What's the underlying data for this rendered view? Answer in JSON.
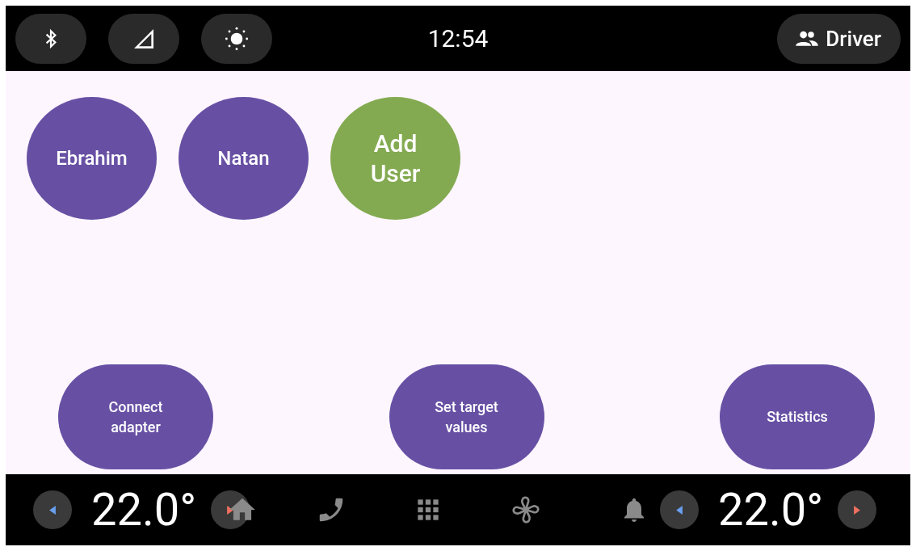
{
  "status_bar": {
    "time": "12:54",
    "user_button": {
      "label": "Driver"
    }
  },
  "users": [
    {
      "label": "Ebrahim",
      "kind": "user"
    },
    {
      "label": "Natan",
      "kind": "user"
    },
    {
      "label": "Add User",
      "kind": "add"
    }
  ],
  "actions": [
    {
      "label": "Connect adapter"
    },
    {
      "label": "Set target values"
    },
    {
      "label": "Statistics"
    }
  ],
  "bottom_bar": {
    "left_temperature": "22.0°",
    "right_temperature": "22.0°"
  }
}
